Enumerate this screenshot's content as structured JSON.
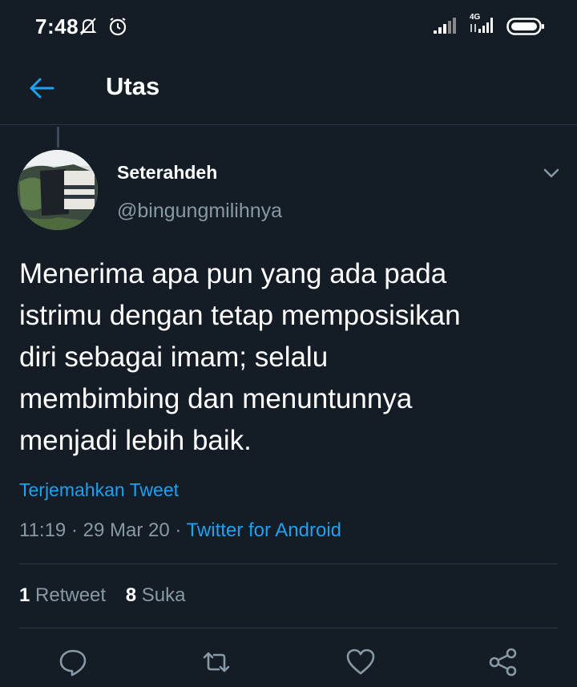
{
  "status_bar": {
    "time": "7:48",
    "network": "4G",
    "icons": [
      "notifications-off-icon",
      "alarm-icon",
      "signal-icon",
      "signal-4g-icon",
      "battery-icon"
    ]
  },
  "header": {
    "title": "Utas",
    "back_icon": "arrow-left-icon"
  },
  "tweet": {
    "author_name": "Seterahdeh",
    "author_handle": "@bingungmilihnya",
    "text": "Menerima apa pun yang ada pada\nistrimu dengan tetap memposisikan\ndiri sebagai imam; selalu\nmembimbing dan menuntunnya\nmenjadi lebih baik.",
    "translate_label": "Terjemahkan Tweet",
    "time": "11:19",
    "date": "29 Mar 20",
    "separator": "·",
    "source": "Twitter for Android",
    "retweet_count": "1",
    "retweet_label": "Retweet",
    "like_count": "8",
    "like_label": "Suka"
  },
  "actions": [
    {
      "name": "reply",
      "icon": "comment-icon"
    },
    {
      "name": "retweet",
      "icon": "retweet-icon"
    },
    {
      "name": "like",
      "icon": "heart-icon"
    },
    {
      "name": "share",
      "icon": "share-icon"
    }
  ],
  "colors": {
    "background": "#141d26",
    "accent": "#1da1f2",
    "muted_text": "#8899a6",
    "divider": "#2b3844"
  }
}
